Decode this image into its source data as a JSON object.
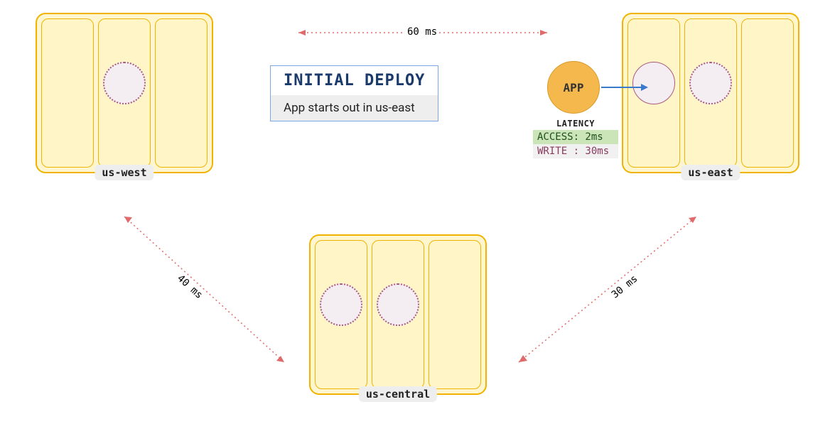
{
  "title": "INITIAL DEPLOY",
  "subtitle": "App starts out in us-east",
  "regions": {
    "west": {
      "label": "us-west"
    },
    "central": {
      "label": "us-central"
    },
    "east": {
      "label": "us-east"
    }
  },
  "latencies": {
    "top": "60 ms",
    "left": "40 ms",
    "right": "30 ms"
  },
  "app": {
    "label": "APP",
    "latency_header": "LATENCY",
    "access": "ACCESS: 2ms",
    "write": "WRITE : 30ms"
  }
}
